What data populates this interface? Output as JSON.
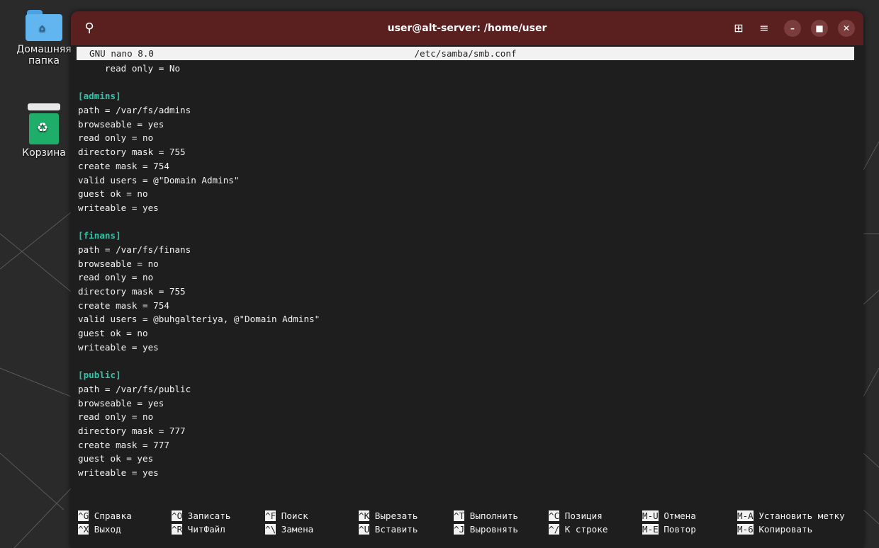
{
  "desktop": {
    "icons": [
      {
        "label_line1": "Домашняя",
        "label_line2": "папка",
        "icon": "home-folder-icon"
      },
      {
        "label_line1": "Корзина",
        "icon": "trash-icon"
      }
    ]
  },
  "window": {
    "title": "user@alt-server: /home/user",
    "buttons": [
      "search-icon",
      "new-tab-icon",
      "menu-icon",
      "minimize-icon",
      "maximize-icon",
      "close-icon"
    ]
  },
  "nano": {
    "version": "GNU nano 8.0",
    "filename": "/etc/samba/smb.conf",
    "lines": [
      {
        "text": "     read only = No",
        "section": false
      },
      {
        "text": "",
        "section": false
      },
      {
        "text": "[admins]",
        "section": true
      },
      {
        "text": "path = /var/fs/admins",
        "section": false
      },
      {
        "text": "browseable = yes",
        "section": false
      },
      {
        "text": "read only = no",
        "section": false
      },
      {
        "text": "directory mask = 755",
        "section": false
      },
      {
        "text": "create mask = 754",
        "section": false
      },
      {
        "text": "valid users = @\"Domain Admins\"",
        "section": false
      },
      {
        "text": "guest ok = no",
        "section": false
      },
      {
        "text": "writeable = yes",
        "section": false
      },
      {
        "text": "",
        "section": false
      },
      {
        "text": "[finans]",
        "section": true
      },
      {
        "text": "path = /var/fs/finans",
        "section": false
      },
      {
        "text": "browseable = no",
        "section": false
      },
      {
        "text": "read only = no",
        "section": false
      },
      {
        "text": "directory mask = 755",
        "section": false
      },
      {
        "text": "create mask = 754",
        "section": false
      },
      {
        "text": "valid users = @buhgalteriya, @\"Domain Admins\"",
        "section": false
      },
      {
        "text": "guest ok = no",
        "section": false
      },
      {
        "text": "writeable = yes",
        "section": false
      },
      {
        "text": "",
        "section": false
      },
      {
        "text": "[public]",
        "section": true
      },
      {
        "text": "path = /var/fs/public",
        "section": false
      },
      {
        "text": "browseable = yes",
        "section": false
      },
      {
        "text": "read only = no",
        "section": false
      },
      {
        "text": "directory mask = 777",
        "section": false
      },
      {
        "text": "create mask = 777",
        "section": false
      },
      {
        "text": "guest ok = yes",
        "section": false
      },
      {
        "text": "writeable = yes",
        "section": false
      }
    ],
    "shortcuts": [
      [
        {
          "key": "^G",
          "label": "Справка"
        },
        {
          "key": "^O",
          "label": "Записать"
        },
        {
          "key": "^F",
          "label": "Поиск"
        },
        {
          "key": "^K",
          "label": "Вырезать"
        },
        {
          "key": "^T",
          "label": "Выполнить"
        },
        {
          "key": "^C",
          "label": "Позиция"
        },
        {
          "key": "M-U",
          "label": "Отмена"
        },
        {
          "key": "M-A",
          "label": "Установить метку"
        }
      ],
      [
        {
          "key": "^X",
          "label": "Выход"
        },
        {
          "key": "^R",
          "label": "ЧитФайл"
        },
        {
          "key": "^\\",
          "label": "Замена"
        },
        {
          "key": "^U",
          "label": "Вставить"
        },
        {
          "key": "^J",
          "label": "Выровнять"
        },
        {
          "key": "^/",
          "label": "К строке"
        },
        {
          "key": "M-E",
          "label": "Повтор"
        },
        {
          "key": "M-6",
          "label": "Копировать"
        }
      ]
    ]
  }
}
